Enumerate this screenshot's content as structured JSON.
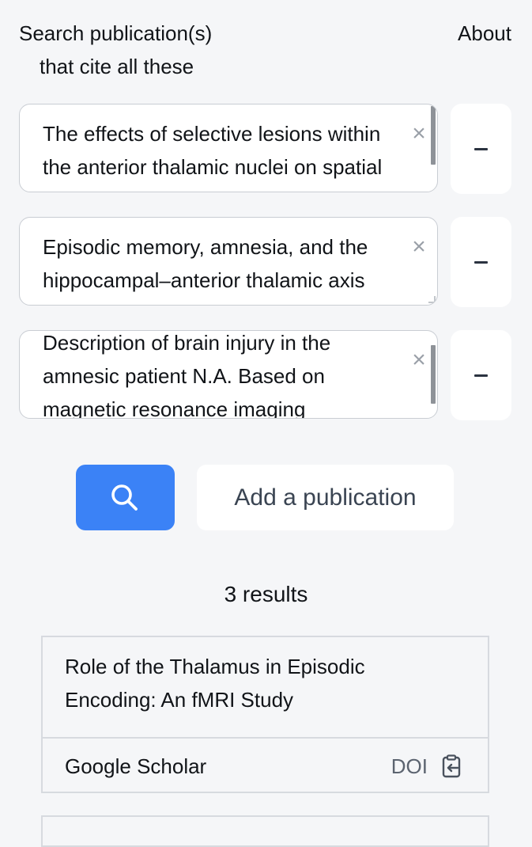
{
  "header": {
    "title": "Search publication(s)",
    "subtitle": "that cite all these",
    "about_label": "About"
  },
  "publications": [
    {
      "text": "The effects of selective lesions within the anterior thalamic nuclei on spatial memory in the rat",
      "clear_glyph": "×",
      "remove_icon": "minus-icon"
    },
    {
      "text": "Episodic memory, amnesia, and the hippocampal–anterior thalamic axis",
      "clear_glyph": "×",
      "remove_icon": "minus-icon"
    },
    {
      "text": "Description of brain injury in the amnesic patient N.A. Based on magnetic resonance imaging",
      "clear_glyph": "×",
      "remove_icon": "minus-icon"
    }
  ],
  "actions": {
    "search_icon": "search-icon",
    "add_label": "Add a publication"
  },
  "results": {
    "count_label": "3 results",
    "items": [
      {
        "title": "Role of the Thalamus in Episodic Encoding: An fMRI Study",
        "scholar_label": "Google Scholar",
        "doi_label": "DOI",
        "copy_icon": "clipboard-copy-icon"
      }
    ]
  },
  "colors": {
    "background": "#f5f6f8",
    "accent": "#3b82f6",
    "border": "#d7dadf"
  }
}
